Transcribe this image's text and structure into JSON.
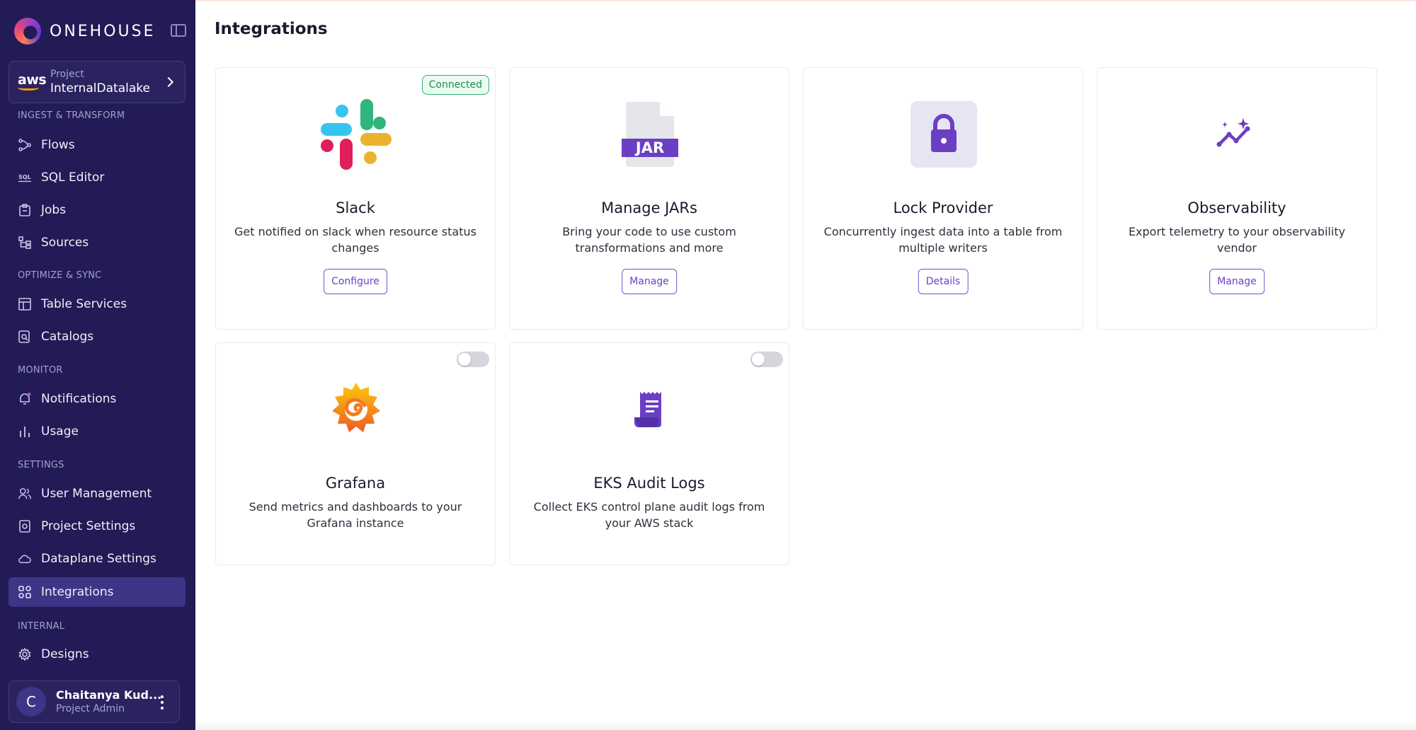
{
  "brand": {
    "name": "ONEHOUSE"
  },
  "project": {
    "provider": "aws",
    "label": "Project",
    "name": "InternalDatalake"
  },
  "sidebar": {
    "sections": [
      {
        "title": "INGEST & TRANSFORM"
      },
      {
        "title": "OPTIMIZE & SYNC"
      },
      {
        "title": "MONITOR"
      },
      {
        "title": "SETTINGS"
      },
      {
        "title": "INTERNAL"
      }
    ],
    "items": [
      {
        "label": "Flows",
        "icon": "flows-icon"
      },
      {
        "label": "SQL Editor",
        "icon": "sql-icon"
      },
      {
        "label": "Jobs",
        "icon": "clipboard-icon"
      },
      {
        "label": "Sources",
        "icon": "sources-icon"
      },
      {
        "label": "Table Services",
        "icon": "table-icon"
      },
      {
        "label": "Catalogs",
        "icon": "catalog-icon"
      },
      {
        "label": "Notifications",
        "icon": "bell-icon"
      },
      {
        "label": "Usage",
        "icon": "bar-chart-icon"
      },
      {
        "label": "User Management",
        "icon": "users-icon"
      },
      {
        "label": "Project Settings",
        "icon": "project-settings-icon"
      },
      {
        "label": "Dataplane Settings",
        "icon": "cloud-icon"
      },
      {
        "label": "Integrations",
        "icon": "integrations-icon",
        "active": true
      },
      {
        "label": "Designs",
        "icon": "gear-icon"
      }
    ]
  },
  "user": {
    "initial": "C",
    "name": "Chaitanya Kud...",
    "role": "Project Admin"
  },
  "page": {
    "title": "Integrations"
  },
  "cards": [
    {
      "title": "Slack",
      "description": "Get notified on slack when resource status changes",
      "button": "Configure",
      "status": "Connected",
      "icon": "slack-icon"
    },
    {
      "title": "Manage JARs",
      "description": "Bring your code to use custom transformations and more",
      "button": "Manage",
      "icon": "jar-file-icon",
      "icon_text": "JAR"
    },
    {
      "title": "Lock Provider",
      "description": "Concurrently ingest data into a table from multiple writers",
      "button": "Details",
      "icon": "lock-icon"
    },
    {
      "title": "Observability",
      "description": "Export telemetry to your observability vendor",
      "button": "Manage",
      "icon": "sparkle-chart-icon"
    },
    {
      "title": "Grafana",
      "description": "Send metrics and dashboards to your Grafana instance",
      "enabled": false,
      "icon": "grafana-icon"
    },
    {
      "title": "EKS Audit Logs",
      "description": "Collect EKS control plane audit logs from your AWS stack",
      "enabled": false,
      "icon": "receipt-icon"
    }
  ],
  "colors": {
    "sidebar_bg": "#221b55",
    "accent": "#6b3fc4",
    "connected": "#1f8d4c"
  }
}
